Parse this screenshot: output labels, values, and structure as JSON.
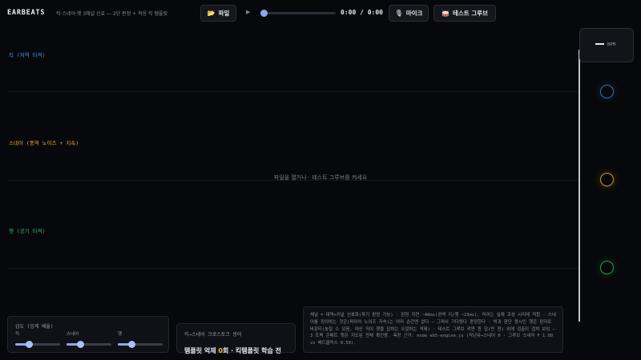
{
  "header": {
    "brand": "EARBEATS",
    "subtitle": "킥·스네어·햇 3채널 신호 — 2단 판정 + 적응 킥 템플릿",
    "file_button": "파일",
    "time": "0:00 / 0:00",
    "mic_button": "마이크",
    "test_groove_button": "테스트 그루브",
    "seek_progress": 0.0
  },
  "icons": {
    "file": "folder-icon",
    "mic": "microphone-icon",
    "test": "drum-icon",
    "play": "play-icon"
  },
  "lanes": [
    {
      "label": "킥 (저역 타격)",
      "color": "#4f8fe0"
    },
    {
      "label": "스네어 (중역 노이즈 + 지속)",
      "color": "#e0a535"
    },
    {
      "label": "햇 (공기 타격)",
      "color": "#34b862"
    }
  ],
  "center_hint": "파일을 열거나 · 테스트 그루브를 켜세요",
  "bpm": {
    "value": "—",
    "unit": "BPM"
  },
  "pads": [
    {
      "name": "kick-pad",
      "color": "#3f6fa8"
    },
    {
      "name": "snare-pad",
      "color": "#c79a2e"
    },
    {
      "name": "hat-pad",
      "color": "#2f9a52"
    }
  ],
  "sensitivity": {
    "title": "감도 (임계 배율)",
    "sliders": [
      {
        "label": "킥",
        "value": 0.3
      },
      {
        "label": "스네어",
        "value": 0.3
      },
      {
        "label": "햇",
        "value": 0.3
      }
    ]
  },
  "crosstalk": {
    "title": "킥→스네어 크로스토크 방어",
    "line_prefix": "템플릿 억제 ",
    "count": "0",
    "line_suffix": "회 · 킥템플릿 학습 전"
  },
  "info": {
    "bold_intro": "대역×커널 신호화",
    "text": "채널 = 대역×커널 신호화(학기 판정 가능) · 판정 지연 ~46ms(공백 지/햇 ~23ms), 마이는 실제 조성 시리에 적합 · 스네어를 정의하는 것은(파이어 노이즈 지속)는 어떠 순간엔 없다 — 그래서 기다렸다 판정한다 · 박과 판단 동시인 햇은 판자로 바운티(놓칠 수 있음, 대신 직이 햇을 답하는 오일하는 억제) · 테스트 그루브 켜면 원 답(빈 원) 위에 검출이 겹쳐 보임 — 3 트랙 콘베트 햇은 지도된 전체 확인용. 측정 근거: node eb5-engine.js (작년뮤→스네어 0 · 그루브 스네어 F 1.00 vs 베드클릭스 0.59)."
  }
}
